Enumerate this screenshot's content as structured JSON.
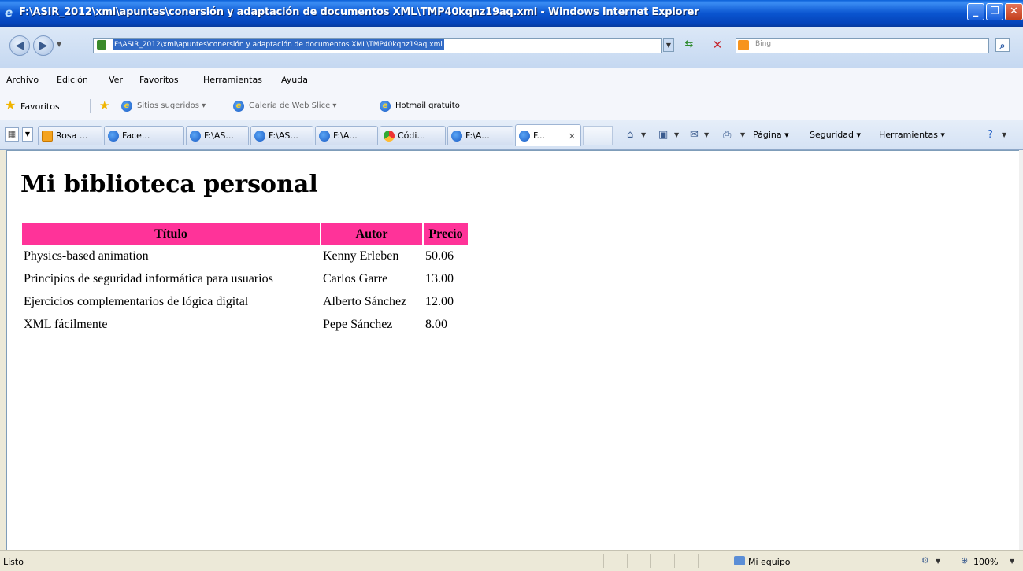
{
  "window": {
    "title": "F:\\ASIR_2012\\xml\\apuntes\\conersión y adaptación de documentos XML\\TMP40kqnz19aq.xml - Windows Internet Explorer",
    "min_icon": "minimize-icon",
    "max_icon": "maximize-icon",
    "close_icon": "close-icon"
  },
  "address_bar": {
    "url": "F:\\ASIR_2012\\xml\\apuntes\\conersión y adaptación de documentos XML\\TMP40kqnz19aq.xml",
    "search_placeholder": "Bing"
  },
  "menu": [
    "Archivo",
    "Edición",
    "Ver",
    "Favoritos",
    "Herramientas",
    "Ayuda"
  ],
  "favorites_bar": {
    "label": "Favoritos",
    "links": [
      "Sitios sugeridos",
      "Galería de Web Slice",
      "Hotmail gratuito"
    ]
  },
  "tabs": [
    {
      "label": "Rosa ...",
      "icon": "page-icon"
    },
    {
      "label": "Face...",
      "icon": "ie-icon"
    },
    {
      "label": "F:\\AS...",
      "icon": "ie-icon"
    },
    {
      "label": "F:\\AS...",
      "icon": "ie-icon"
    },
    {
      "label": "F:\\A...",
      "icon": "ie-icon"
    },
    {
      "label": "Códi...",
      "icon": "chrome-icon"
    },
    {
      "label": "F:\\A...",
      "icon": "ie-icon"
    },
    {
      "label": "F...",
      "icon": "ie-icon",
      "active": true
    }
  ],
  "command_bar": {
    "page": "Página",
    "security": "Seguridad",
    "tools": "Herramientas"
  },
  "page": {
    "heading": "Mi biblioteca personal",
    "columns": [
      "Título",
      "Autor",
      "Precio"
    ],
    "rows": [
      [
        "Physics-based animation",
        "Kenny Erleben",
        "50.06"
      ],
      [
        "Principios de seguridad informática para usuarios",
        "Carlos Garre",
        "13.00"
      ],
      [
        "Ejercicios complementarios de lógica digital",
        "Alberto Sánchez",
        "12.00"
      ],
      [
        "XML fácilmente",
        "Pepe Sánchez",
        "8.00"
      ]
    ],
    "header_color": "#ff3399"
  },
  "status_bar": {
    "text": "Listo",
    "zone": "Mi equipo",
    "zoom": "100%"
  }
}
